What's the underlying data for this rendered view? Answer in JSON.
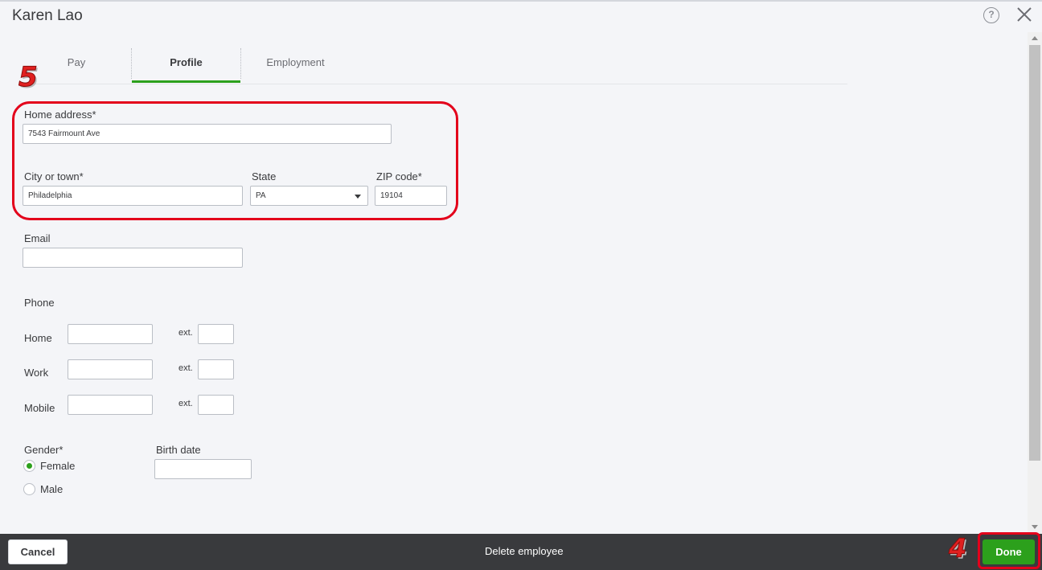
{
  "header": {
    "title": "Karen Lao",
    "help_symbol": "?"
  },
  "tabs": [
    {
      "label": "Pay",
      "active": false
    },
    {
      "label": "Profile",
      "active": true
    },
    {
      "label": "Employment",
      "active": false
    }
  ],
  "annotations": {
    "step_address": "5",
    "step_done": "4",
    "highlight_color": "#e3001b"
  },
  "address": {
    "home_label": "Home address*",
    "home_value": "7543 Fairmount Ave",
    "city_label": "City or town*",
    "city_value": "Philadelphia",
    "state_label": "State",
    "state_value": "PA",
    "zip_label": "ZIP code*",
    "zip_value": "19104"
  },
  "email": {
    "label": "Email",
    "value": ""
  },
  "phone": {
    "section_label": "Phone",
    "ext_label": "ext.",
    "rows": [
      {
        "label": "Home",
        "value": "",
        "ext": ""
      },
      {
        "label": "Work",
        "value": "",
        "ext": ""
      },
      {
        "label": "Mobile",
        "value": "",
        "ext": ""
      }
    ]
  },
  "gender": {
    "label": "Gender*",
    "options": [
      {
        "label": "Female",
        "selected": true
      },
      {
        "label": "Male",
        "selected": false
      }
    ]
  },
  "birth_date": {
    "label": "Birth date",
    "value": ""
  },
  "footer": {
    "cancel_label": "Cancel",
    "delete_label": "Delete employee",
    "done_label": "Done"
  },
  "colors": {
    "accent": "#2ca01c",
    "footer_bg": "#393a3d",
    "page_bg": "#f4f5f8"
  },
  "icons": [
    "help-icon",
    "close-icon",
    "chevron-down-icon",
    "scroll-up-icon",
    "scroll-down-icon"
  ]
}
